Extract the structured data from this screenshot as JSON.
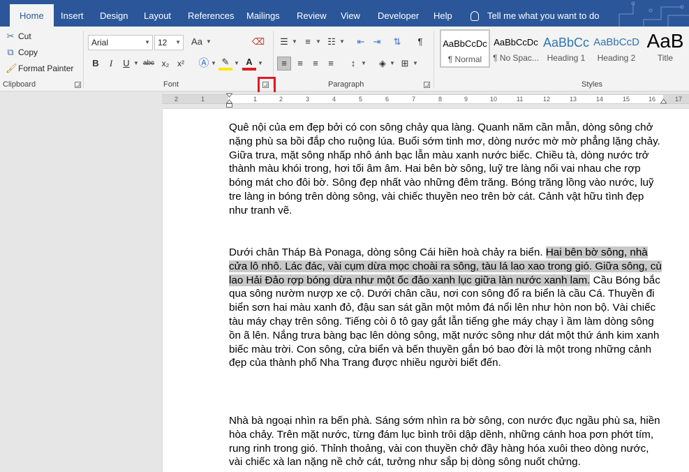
{
  "tabs": [
    {
      "label": "Home",
      "active": true
    },
    {
      "label": "Insert"
    },
    {
      "label": "Design"
    },
    {
      "label": "Layout"
    },
    {
      "label": "References"
    },
    {
      "label": "Mailings"
    },
    {
      "label": "Review"
    },
    {
      "label": "View"
    },
    {
      "label": "Developer"
    },
    {
      "label": "Help"
    }
  ],
  "tell_me": "Tell me what you want to do",
  "clipboard": {
    "cut": "Cut",
    "copy": "Copy",
    "format_painter": "Format Painter",
    "label": "Clipboard"
  },
  "font": {
    "family": "Arial",
    "size": "12",
    "change_case": "Aa",
    "bold": "B",
    "italic": "I",
    "underline": "U",
    "strike": "abc",
    "subscript": "x₂",
    "superscript": "x²",
    "label": "Font"
  },
  "paragraph": {
    "label": "Paragraph",
    "pilcrow": "¶"
  },
  "styles": {
    "label": "Styles",
    "items": [
      {
        "preview": "AaBbCcDc",
        "name": "¶ Normal"
      },
      {
        "preview": "AaBbCcDc",
        "name": "¶ No Spac..."
      },
      {
        "preview": "AaBbCc",
        "name": "Heading 1"
      },
      {
        "preview": "AaBbCcD",
        "name": "Heading 2"
      },
      {
        "preview": "AaB",
        "name": "Title"
      }
    ]
  },
  "ruler": {
    "numbers": [
      "2",
      "1",
      "1",
      "2",
      "3",
      "4",
      "5",
      "6",
      "7",
      "8",
      "9",
      "10",
      "11",
      "12",
      "13",
      "14",
      "15",
      "16",
      "17"
    ]
  },
  "colors": {
    "accent": "#2b579a",
    "highlight_box": "#e01b24",
    "selection": "#c8c8c8"
  },
  "document": {
    "para1": "Quê nội của em đẹp bởi có con sông chảy qua làng. Quanh năm cần mẫn, dòng sông chở nặng phù sa bồi đắp cho ruộng lúa. Buổi sớm tinh mơ, dòng nước mờ mờ phẳng lặng chảy. Giữa trưa, mặt sông nhấp nhô ánh bạc lẫn màu xanh nước biếc. Chiều tà, dòng nước trở thành màu khói trong, hơi tối âm âm. Hai bên bờ sông, luỹ tre làng nối vai nhau che rợp bóng mát cho đôi bờ. Sông đẹp nhất vào những đêm trăng. Bóng trăng lồng vào nước, luỹ tre làng in bóng trên dòng sông, vài chiếc thuyền neo trên bờ cát. Cảnh vật hữu tình đẹp như tranh vẽ.",
    "para2_a": "Dưới chân Tháp Bà Ponaga, dòng sông Cái hiền hoà chảy ra biển. ",
    "para2_selected": "Hai bên bờ sông, nhà cửa lô nhô. Lác đác, vài cụm dừa mọc choài ra sông, tàu lá lao xao trong gió. Giữa sông, cù lao Hải Đảo rợp bóng dừa như một ốc đảo xanh lục giữa làn nước xanh lam.",
    "para2_b": " Cầu Bóng bắc qua sông nườm nượp xe cộ. Dưới chân cầu, nơi con sông đổ ra biển là cầu Cá. Thuyền đi biển sơn hai màu xanh đỏ, đậu san sát gần một mỏm đá nổi lên như hòn non bộ. Vài chiếc tàu máy chạy trên sông. Tiếng còi ô tô gay gắt lẫn tiếng ghe máy chạy ì ầm làm dòng sông ồn ã lên. Nắng trưa bàng bạc lên dòng sông, mặt nước sông như dát một thứ ánh kim xanh biếc màu trời. Con sông, cửa biển và bến thuyền gắn bó bao đời là một trong những cảnh đẹp của thành phố Nha Trang được nhiều người biết đến.",
    "para3": "Nhà bà ngoại nhìn ra bến phà. Sáng sớm nhìn ra bờ sông, con nước đục ngầu phù sa, hiền hòa chảy. Trên mặt nước, từng đám lục bình trôi dập dềnh, những cánh hoa pơn phớt tím, rung rinh trong gió. Thỉnh thoảng, vài con thuyền chở đầy hàng hóa xuôi theo dòng nước, vài chiếc xà lan nặng nề chở cát, tưởng như sắp bị dòng sông nuốt chửng."
  }
}
